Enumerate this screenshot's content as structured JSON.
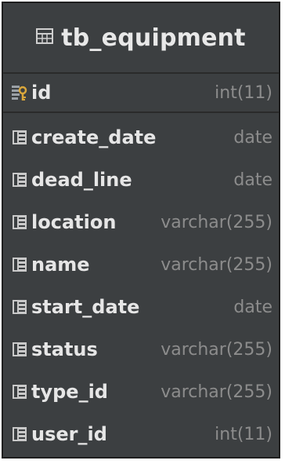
{
  "table": {
    "name": "tb_equipment",
    "primary_key": {
      "name": "id",
      "type": "int(11)",
      "icon": "primary-key-column-icon"
    },
    "columns": [
      {
        "name": "create_date",
        "type": "date",
        "icon": "column-icon"
      },
      {
        "name": "dead_line",
        "type": "date",
        "icon": "column-icon"
      },
      {
        "name": "location",
        "type": "varchar(255)",
        "icon": "column-icon"
      },
      {
        "name": "name",
        "type": "varchar(255)",
        "icon": "column-icon"
      },
      {
        "name": "start_date",
        "type": "date",
        "icon": "column-icon"
      },
      {
        "name": "status",
        "type": "varchar(255)",
        "icon": "column-icon"
      },
      {
        "name": "type_id",
        "type": "varchar(255)",
        "icon": "column-icon"
      },
      {
        "name": "user_id",
        "type": "int(11)",
        "icon": "column-icon"
      }
    ]
  },
  "colors": {
    "background": "#3c3f41",
    "text": "#e6e6e6",
    "type_text": "#8c8c8c",
    "key_icon": "#d9a63b"
  }
}
